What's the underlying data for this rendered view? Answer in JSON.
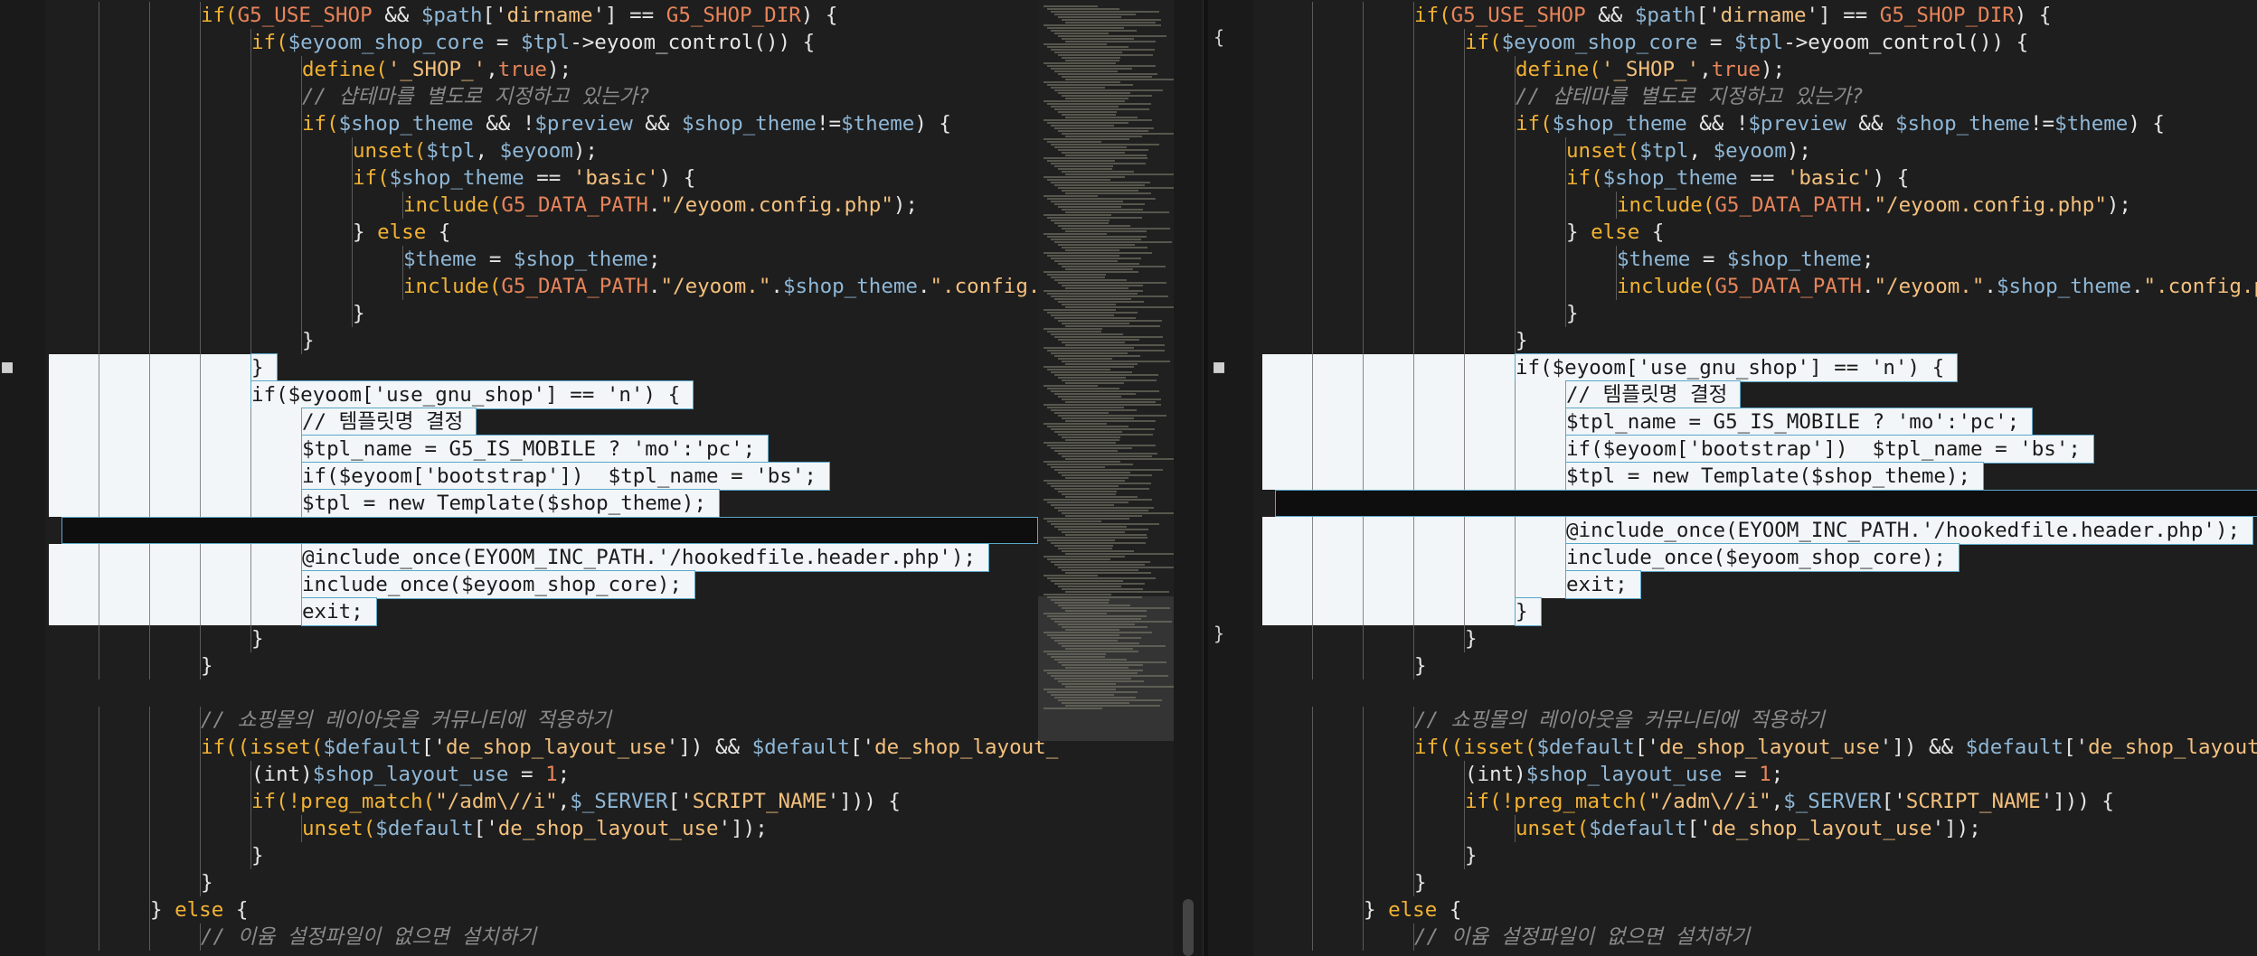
{
  "left_pane": {
    "lines": [
      {
        "indent": 3,
        "tokens": [
          [
            "kw",
            "if("
          ],
          [
            "const",
            "G5_USE_SHOP"
          ],
          [
            "pl",
            " && "
          ],
          [
            "var",
            "$path"
          ],
          [
            "pl",
            "['"
          ],
          [
            "str",
            "dirname"
          ],
          [
            "pl",
            "'] == "
          ],
          [
            "const",
            "G5_SHOP_DIR"
          ],
          [
            "pl",
            ") {"
          ]
        ]
      },
      {
        "indent": 4,
        "tokens": [
          [
            "kw",
            "if("
          ],
          [
            "var",
            "$eyoom_shop_core"
          ],
          [
            "pl",
            " = "
          ],
          [
            "var",
            "$tpl"
          ],
          [
            "pl",
            "->eyoom_control()) {"
          ]
        ]
      },
      {
        "indent": 5,
        "tokens": [
          [
            "kw",
            "define("
          ],
          [
            "str",
            "'_SHOP_'"
          ],
          [
            "pl",
            ","
          ],
          [
            "const",
            "true"
          ],
          [
            "pl",
            ");"
          ]
        ]
      },
      {
        "indent": 5,
        "tokens": [
          [
            "cm",
            "// 샵테마를 별도로 지정하고 있는가?"
          ]
        ]
      },
      {
        "indent": 5,
        "tokens": [
          [
            "kw",
            "if("
          ],
          [
            "var",
            "$shop_theme"
          ],
          [
            "pl",
            " && !"
          ],
          [
            "var",
            "$preview"
          ],
          [
            "pl",
            " && "
          ],
          [
            "var",
            "$shop_theme"
          ],
          [
            "pl",
            "!="
          ],
          [
            "var",
            "$theme"
          ],
          [
            "pl",
            ") {"
          ]
        ]
      },
      {
        "indent": 6,
        "tokens": [
          [
            "kw",
            "unset("
          ],
          [
            "var",
            "$tpl"
          ],
          [
            "pl",
            ", "
          ],
          [
            "var",
            "$eyoom"
          ],
          [
            "pl",
            ");"
          ]
        ]
      },
      {
        "indent": 6,
        "tokens": [
          [
            "kw",
            "if("
          ],
          [
            "var",
            "$shop_theme"
          ],
          [
            "pl",
            " == "
          ],
          [
            "str",
            "'basic'"
          ],
          [
            "pl",
            ") {"
          ]
        ]
      },
      {
        "indent": 7,
        "tokens": [
          [
            "kw",
            "include("
          ],
          [
            "const",
            "G5_DATA_PATH"
          ],
          [
            "pl",
            "."
          ],
          [
            "str",
            "\"/eyoom.config.php\""
          ],
          [
            "pl",
            ");"
          ]
        ]
      },
      {
        "indent": 6,
        "tokens": [
          [
            "pl",
            "} "
          ],
          [
            "kw",
            "else"
          ],
          [
            "pl",
            " {"
          ]
        ]
      },
      {
        "indent": 7,
        "tokens": [
          [
            "var",
            "$theme"
          ],
          [
            "pl",
            " = "
          ],
          [
            "var",
            "$shop_theme"
          ],
          [
            "pl",
            ";"
          ]
        ]
      },
      {
        "indent": 7,
        "tokens": [
          [
            "kw",
            "include("
          ],
          [
            "const",
            "G5_DATA_PATH"
          ],
          [
            "pl",
            "."
          ],
          [
            "str",
            "\"/eyoom.\""
          ],
          [
            "pl",
            "."
          ],
          [
            "var",
            "$shop_theme"
          ],
          [
            "pl",
            "."
          ],
          [
            "str",
            "\".config.php\""
          ],
          [
            "pl",
            ");"
          ]
        ]
      },
      {
        "indent": 6,
        "tokens": [
          [
            "pl",
            "}"
          ]
        ]
      },
      {
        "indent": 5,
        "tokens": [
          [
            "pl",
            "}"
          ]
        ]
      },
      {
        "indent": 4,
        "sel": true,
        "tokens": [
          [
            "pl",
            "}"
          ]
        ]
      },
      {
        "indent": 4,
        "sel": true,
        "tokens": [
          [
            "pl",
            "if($eyoom['use_gnu_shop'] == 'n') {"
          ]
        ]
      },
      {
        "indent": 5,
        "sel": true,
        "tokens": [
          [
            "pl",
            "// 템플릿명 결정"
          ]
        ]
      },
      {
        "indent": 5,
        "sel": true,
        "tokens": [
          [
            "pl",
            "$tpl_name = G5_IS_MOBILE ? 'mo':'pc';"
          ]
        ]
      },
      {
        "indent": 5,
        "sel": true,
        "tokens": [
          [
            "pl",
            "if($eyoom['bootstrap'])  $tpl_name = 'bs';"
          ]
        ]
      },
      {
        "indent": 5,
        "sel": true,
        "tokens": [
          [
            "pl",
            "$tpl = new Template($shop_theme);"
          ]
        ]
      },
      {
        "indent": 0,
        "selbar": true,
        "tokens": []
      },
      {
        "indent": 5,
        "sel": true,
        "tokens": [
          [
            "pl",
            "@include_once(EYOOM_INC_PATH.'/hookedfile.header.php');"
          ]
        ]
      },
      {
        "indent": 5,
        "sel": true,
        "tokens": [
          [
            "pl",
            "include_once($eyoom_shop_core);"
          ]
        ]
      },
      {
        "indent": 5,
        "sel": true,
        "tokens": [
          [
            "pl",
            "exit;"
          ]
        ]
      },
      {
        "indent": 4,
        "tokens": [
          [
            "pl",
            "}"
          ]
        ]
      },
      {
        "indent": 3,
        "tokens": [
          [
            "pl",
            "}"
          ]
        ]
      },
      {
        "indent": 0,
        "tokens": []
      },
      {
        "indent": 3,
        "tokens": [
          [
            "cm",
            "// 쇼핑몰의 레이아웃을 커뮤니티에 적용하기"
          ]
        ]
      },
      {
        "indent": 3,
        "tokens": [
          [
            "kw",
            "if((isset("
          ],
          [
            "var",
            "$default"
          ],
          [
            "pl",
            "['"
          ],
          [
            "str",
            "de_shop_layout_use"
          ],
          [
            "pl",
            "']) && "
          ],
          [
            "var",
            "$default"
          ],
          [
            "pl",
            "['"
          ],
          [
            "str",
            "de_shop_layout_"
          ]
        ]
      },
      {
        "indent": 4,
        "tokens": [
          [
            "pl",
            "(int)"
          ],
          [
            "var",
            "$shop_layout_use"
          ],
          [
            "pl",
            " = "
          ],
          [
            "num",
            "1"
          ],
          [
            "pl",
            ";"
          ]
        ]
      },
      {
        "indent": 4,
        "tokens": [
          [
            "kw",
            "if(!preg_match("
          ],
          [
            "str",
            "\"/adm\\//i\""
          ],
          [
            "pl",
            ","
          ],
          [
            "var",
            "$_SERVER"
          ],
          [
            "pl",
            "['"
          ],
          [
            "str",
            "SCRIPT_NAME"
          ],
          [
            "pl",
            "'])) {"
          ]
        ]
      },
      {
        "indent": 5,
        "tokens": [
          [
            "kw",
            "unset("
          ],
          [
            "var",
            "$default"
          ],
          [
            "pl",
            "['"
          ],
          [
            "str",
            "de_shop_layout_use"
          ],
          [
            "pl",
            "']);"
          ]
        ]
      },
      {
        "indent": 4,
        "tokens": [
          [
            "pl",
            "}"
          ]
        ]
      },
      {
        "indent": 3,
        "tokens": [
          [
            "pl",
            "}"
          ]
        ]
      },
      {
        "indent": 2,
        "tokens": [
          [
            "pl",
            "} "
          ],
          [
            "kw",
            "else"
          ],
          [
            "pl",
            " {"
          ]
        ]
      },
      {
        "indent": 3,
        "tokens": [
          [
            "cm",
            "// 이윰 설정파일이 없으면 설치하기"
          ]
        ]
      }
    ]
  },
  "right_pane": {
    "lines": [
      {
        "indent": 3,
        "tokens": [
          [
            "kw",
            "if("
          ],
          [
            "const",
            "G5_USE_SHOP"
          ],
          [
            "pl",
            " && "
          ],
          [
            "var",
            "$path"
          ],
          [
            "pl",
            "['"
          ],
          [
            "str",
            "dirname"
          ],
          [
            "pl",
            "'] == "
          ],
          [
            "const",
            "G5_SHOP_DIR"
          ],
          [
            "pl",
            ") {"
          ]
        ]
      },
      {
        "indent": 4,
        "tokens": [
          [
            "kw",
            "if("
          ],
          [
            "var",
            "$eyoom_shop_core"
          ],
          [
            "pl",
            " = "
          ],
          [
            "var",
            "$tpl"
          ],
          [
            "pl",
            "->eyoom_control()) {"
          ]
        ]
      },
      {
        "indent": 5,
        "tokens": [
          [
            "kw",
            "define("
          ],
          [
            "str",
            "'_SHOP_'"
          ],
          [
            "pl",
            ","
          ],
          [
            "const",
            "true"
          ],
          [
            "pl",
            ");"
          ]
        ]
      },
      {
        "indent": 5,
        "tokens": [
          [
            "cm",
            "// 샵테마를 별도로 지정하고 있는가?"
          ]
        ]
      },
      {
        "indent": 5,
        "tokens": [
          [
            "kw",
            "if("
          ],
          [
            "var",
            "$shop_theme"
          ],
          [
            "pl",
            " && !"
          ],
          [
            "var",
            "$preview"
          ],
          [
            "pl",
            " && "
          ],
          [
            "var",
            "$shop_theme"
          ],
          [
            "pl",
            "!="
          ],
          [
            "var",
            "$theme"
          ],
          [
            "pl",
            ") {"
          ]
        ]
      },
      {
        "indent": 6,
        "tokens": [
          [
            "kw",
            "unset("
          ],
          [
            "var",
            "$tpl"
          ],
          [
            "pl",
            ", "
          ],
          [
            "var",
            "$eyoom"
          ],
          [
            "pl",
            ");"
          ]
        ]
      },
      {
        "indent": 6,
        "tokens": [
          [
            "kw",
            "if("
          ],
          [
            "var",
            "$shop_theme"
          ],
          [
            "pl",
            " == "
          ],
          [
            "str",
            "'basic'"
          ],
          [
            "pl",
            ") {"
          ]
        ]
      },
      {
        "indent": 7,
        "tokens": [
          [
            "kw",
            "include("
          ],
          [
            "const",
            "G5_DATA_PATH"
          ],
          [
            "pl",
            "."
          ],
          [
            "str",
            "\"/eyoom.config.php\""
          ],
          [
            "pl",
            ");"
          ]
        ]
      },
      {
        "indent": 6,
        "tokens": [
          [
            "pl",
            "} "
          ],
          [
            "kw",
            "else"
          ],
          [
            "pl",
            " {"
          ]
        ]
      },
      {
        "indent": 7,
        "tokens": [
          [
            "var",
            "$theme"
          ],
          [
            "pl",
            " = "
          ],
          [
            "var",
            "$shop_theme"
          ],
          [
            "pl",
            ";"
          ]
        ]
      },
      {
        "indent": 7,
        "tokens": [
          [
            "kw",
            "include("
          ],
          [
            "const",
            "G5_DATA_PATH"
          ],
          [
            "pl",
            "."
          ],
          [
            "str",
            "\"/eyoom.\""
          ],
          [
            "pl",
            "."
          ],
          [
            "var",
            "$shop_theme"
          ],
          [
            "pl",
            "."
          ],
          [
            "str",
            "\".config.php\""
          ],
          [
            "pl",
            ");"
          ]
        ]
      },
      {
        "indent": 6,
        "tokens": [
          [
            "pl",
            "}"
          ]
        ]
      },
      {
        "indent": 5,
        "tokens": [
          [
            "pl",
            "}"
          ]
        ]
      },
      {
        "indent": 5,
        "sel": true,
        "tokens": [
          [
            "pl",
            "if($eyoom['use_gnu_shop'] == 'n') {"
          ]
        ]
      },
      {
        "indent": 6,
        "sel": true,
        "tokens": [
          [
            "pl",
            "// 템플릿명 결정"
          ]
        ]
      },
      {
        "indent": 6,
        "sel": true,
        "tokens": [
          [
            "pl",
            "$tpl_name = G5_IS_MOBILE ? 'mo':'pc';"
          ]
        ]
      },
      {
        "indent": 6,
        "sel": true,
        "tokens": [
          [
            "pl",
            "if($eyoom['bootstrap'])  $tpl_name = 'bs';"
          ]
        ]
      },
      {
        "indent": 6,
        "sel": true,
        "tokens": [
          [
            "pl",
            "$tpl = new Template($shop_theme);"
          ]
        ]
      },
      {
        "indent": 0,
        "selbar": true,
        "tokens": []
      },
      {
        "indent": 6,
        "sel": true,
        "tokens": [
          [
            "pl",
            "@include_once(EYOOM_INC_PATH.'/hookedfile.header.php');"
          ]
        ]
      },
      {
        "indent": 6,
        "sel": true,
        "tokens": [
          [
            "pl",
            "include_once($eyoom_shop_core);"
          ]
        ]
      },
      {
        "indent": 6,
        "sel": true,
        "tokens": [
          [
            "pl",
            "exit;"
          ]
        ]
      },
      {
        "indent": 5,
        "sel": true,
        "tokens": [
          [
            "pl",
            "}"
          ]
        ]
      },
      {
        "indent": 4,
        "tokens": [
          [
            "pl",
            "}"
          ]
        ]
      },
      {
        "indent": 3,
        "tokens": [
          [
            "pl",
            "}"
          ]
        ]
      },
      {
        "indent": 0,
        "tokens": []
      },
      {
        "indent": 3,
        "tokens": [
          [
            "cm",
            "// 쇼핑몰의 레이아웃을 커뮤니티에 적용하기"
          ]
        ]
      },
      {
        "indent": 3,
        "tokens": [
          [
            "kw",
            "if((isset("
          ],
          [
            "var",
            "$default"
          ],
          [
            "pl",
            "['"
          ],
          [
            "str",
            "de_shop_layout_use"
          ],
          [
            "pl",
            "']) && "
          ],
          [
            "var",
            "$default"
          ],
          [
            "pl",
            "['"
          ],
          [
            "str",
            "de_shop_layout_u"
          ]
        ]
      },
      {
        "indent": 4,
        "tokens": [
          [
            "pl",
            "(int)"
          ],
          [
            "var",
            "$shop_layout_use"
          ],
          [
            "pl",
            " = "
          ],
          [
            "num",
            "1"
          ],
          [
            "pl",
            ";"
          ]
        ]
      },
      {
        "indent": 4,
        "tokens": [
          [
            "kw",
            "if(!preg_match("
          ],
          [
            "str",
            "\"/adm\\//i\""
          ],
          [
            "pl",
            ","
          ],
          [
            "var",
            "$_SERVER"
          ],
          [
            "pl",
            "['"
          ],
          [
            "str",
            "SCRIPT_NAME"
          ],
          [
            "pl",
            "'])) {"
          ]
        ]
      },
      {
        "indent": 5,
        "tokens": [
          [
            "kw",
            "unset("
          ],
          [
            "var",
            "$default"
          ],
          [
            "pl",
            "['"
          ],
          [
            "str",
            "de_shop_layout_use"
          ],
          [
            "pl",
            "']);"
          ]
        ]
      },
      {
        "indent": 4,
        "tokens": [
          [
            "pl",
            "}"
          ]
        ]
      },
      {
        "indent": 3,
        "tokens": [
          [
            "pl",
            "}"
          ]
        ]
      },
      {
        "indent": 2,
        "tokens": [
          [
            "pl",
            "} "
          ],
          [
            "kw",
            "else"
          ],
          [
            "pl",
            " {"
          ]
        ]
      },
      {
        "indent": 3,
        "tokens": [
          [
            "cm",
            "// 이윰 설정파일이 없으면 설치하기"
          ]
        ]
      }
    ]
  },
  "right_gutter": {
    "open_brace": "{",
    "close_brace": "}"
  },
  "colors": {
    "background": "#1e1e1e",
    "selection": "#f2f6f8",
    "keyword": "#f2b233",
    "variable": "#8fb7d6",
    "string": "#f4c07d",
    "constant": "#e8845a",
    "comment": "#8a8a8a"
  }
}
